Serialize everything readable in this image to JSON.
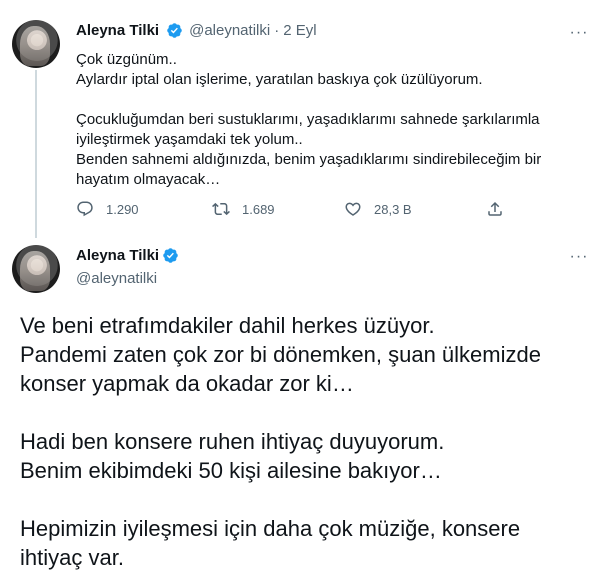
{
  "tweet1": {
    "author": {
      "name": "Aleyna Tilki",
      "handle": "@aleynatilki",
      "separator": "·",
      "date": "2 Eyl"
    },
    "more_label": "···",
    "lines": [
      "Çok üzgünüm..",
      "Aylardır iptal olan işlerime, yaratılan baskıya çok üzülüyorum.",
      "",
      "Çocukluğumdan beri sustuklarımı, yaşadıklarımı sahnede şarkılarımla",
      "iyileştirmek yaşamdaki tek yolum..",
      "Benden sahnemi aldığınızda, benim yaşadıklarımı sindirebileceğim bir",
      "hayatım olmayacak…"
    ],
    "actions": {
      "reply_count": "1.290",
      "retweet_count": "1.689",
      "like_count": "28,3 B"
    },
    "icons": [
      "reply-icon",
      "retweet-icon",
      "like-icon",
      "share-icon",
      "verified-icon",
      "more-icon"
    ]
  },
  "tweet2": {
    "author": {
      "name": "Aleyna Tilki",
      "handle": "@aleynatilki"
    },
    "more_label": "···",
    "paragraphs": [
      "Ve beni etrafımdakiler dahil herkes üzüyor.",
      "Pandemi zaten çok zor bi dönemken, şuan ülkemizde",
      "konser yapmak da okadar zor ki…",
      "",
      "Hadi ben konsere ruhen ihtiyaç duyuyorum.",
      "Benim ekibimdeki 50 kişi ailesine bakıyor…",
      "",
      "Hepimizin iyileşmesi için daha çok müziğe, konsere",
      "ihtiyaç var."
    ]
  },
  "colors": {
    "text_primary": "#0f1419",
    "text_secondary": "#536471",
    "verified_blue": "#1d9bf0",
    "thread_line": "#cfd9de"
  }
}
